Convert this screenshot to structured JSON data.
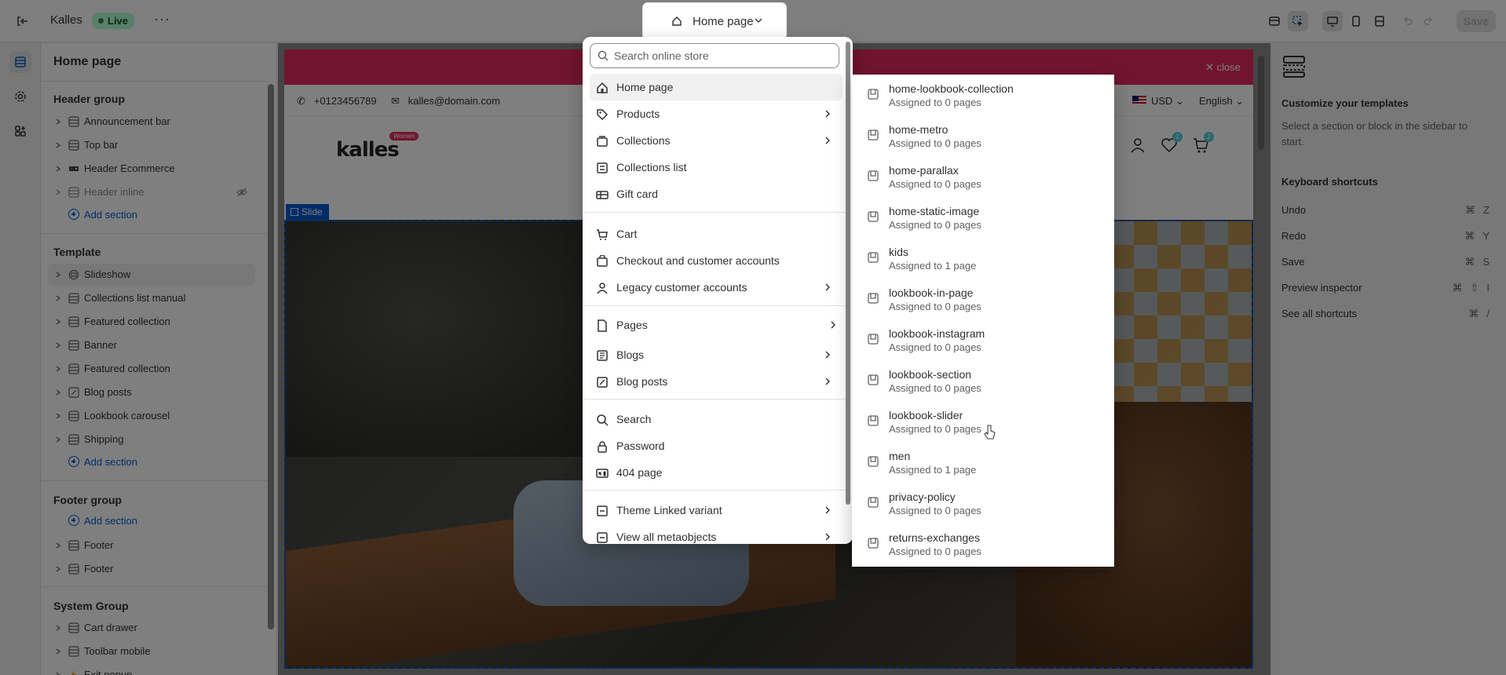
{
  "topbar": {
    "store_name": "Kalles",
    "status": "Live",
    "page_selector": "Home page",
    "save_label": "Save"
  },
  "sidebar": {
    "title": "Home page",
    "header_group": {
      "label": "Header group",
      "items": [
        "Announcement bar",
        "Top bar",
        "Header Ecommerce",
        "Header inline"
      ],
      "add": "Add section"
    },
    "template": {
      "label": "Template",
      "items": [
        "Slideshow",
        "Collections list manual",
        "Featured collection",
        "Banner",
        "Featured collection",
        "Blog posts",
        "Lookbook carousel",
        "Shipping"
      ],
      "add": "Add section"
    },
    "footer_group": {
      "label": "Footer group",
      "add": "Add section",
      "items": [
        "Footer",
        "Footer"
      ]
    },
    "system_group": {
      "label": "System Group",
      "items": [
        "Cart drawer",
        "Toolbar mobile",
        "Exit popup"
      ]
    }
  },
  "preview": {
    "announcement_close": "close",
    "phone": "+0123456789",
    "email": "kalles@domain.com",
    "currency": "USD",
    "language": "English",
    "logo_text": "kalles",
    "logo_badge": "Women",
    "wishlist_count": "2",
    "cart_count": "2",
    "slide_tag": "Slide"
  },
  "right_panel": {
    "title": "Customize your templates",
    "description": "Select a section or block in the sidebar to start.",
    "shortcuts_title": "Keyboard shortcuts",
    "shortcuts": [
      {
        "label": "Undo",
        "keys": "⌘Z"
      },
      {
        "label": "Redo",
        "keys": "⌘Y"
      },
      {
        "label": "Save",
        "keys": "⌘S"
      },
      {
        "label": "Preview inspector",
        "keys": "⌘⇧I"
      },
      {
        "label": "See all shortcuts",
        "keys": "⌘/"
      }
    ]
  },
  "menu": {
    "search_placeholder": "Search online store",
    "items": [
      {
        "label": "Home page",
        "icon": "home-icon"
      },
      {
        "label": "Products",
        "icon": "tag-icon",
        "submenu": true
      },
      {
        "label": "Collections",
        "icon": "collection-icon",
        "submenu": true
      },
      {
        "label": "Collections list",
        "icon": "list-icon"
      },
      {
        "label": "Gift card",
        "icon": "gift-card-icon"
      },
      {
        "label": "Cart",
        "icon": "cart-icon"
      },
      {
        "label": "Checkout and customer accounts",
        "icon": "checkout-icon"
      },
      {
        "label": "Legacy customer accounts",
        "icon": "person-icon",
        "submenu": true
      },
      {
        "label": "Pages",
        "icon": "page-icon",
        "submenu": true
      },
      {
        "label": "Blogs",
        "icon": "blog-icon",
        "submenu": true
      },
      {
        "label": "Blog posts",
        "icon": "post-icon",
        "submenu": true
      },
      {
        "label": "Search",
        "icon": "search-icon"
      },
      {
        "label": "Password",
        "icon": "lock-icon"
      },
      {
        "label": "404 page",
        "icon": "404-icon"
      },
      {
        "label": "Theme Linked variant",
        "icon": "metaobject-icon",
        "submenu": true
      },
      {
        "label": "View all metaobjects",
        "icon": "metaobject-icon",
        "submenu": true
      }
    ]
  },
  "submenu": {
    "items": [
      {
        "name": "home-lookbook-collection",
        "assigned": "Assigned to 0 pages"
      },
      {
        "name": "home-metro",
        "assigned": "Assigned to 0 pages"
      },
      {
        "name": "home-parallax",
        "assigned": "Assigned to 0 pages"
      },
      {
        "name": "home-static-image",
        "assigned": "Assigned to 0 pages"
      },
      {
        "name": "kids",
        "assigned": "Assigned to 1 page"
      },
      {
        "name": "lookbook-in-page",
        "assigned": "Assigned to 0 pages"
      },
      {
        "name": "lookbook-instagram",
        "assigned": "Assigned to 0 pages"
      },
      {
        "name": "lookbook-section",
        "assigned": "Assigned to 0 pages"
      },
      {
        "name": "lookbook-slider",
        "assigned": "Assigned to 0 pages"
      },
      {
        "name": "men",
        "assigned": "Assigned to 1 page"
      },
      {
        "name": "privacy-policy",
        "assigned": "Assigned to 0 pages"
      },
      {
        "name": "returns-exchanges",
        "assigned": "Assigned to 0 pages"
      }
    ]
  }
}
